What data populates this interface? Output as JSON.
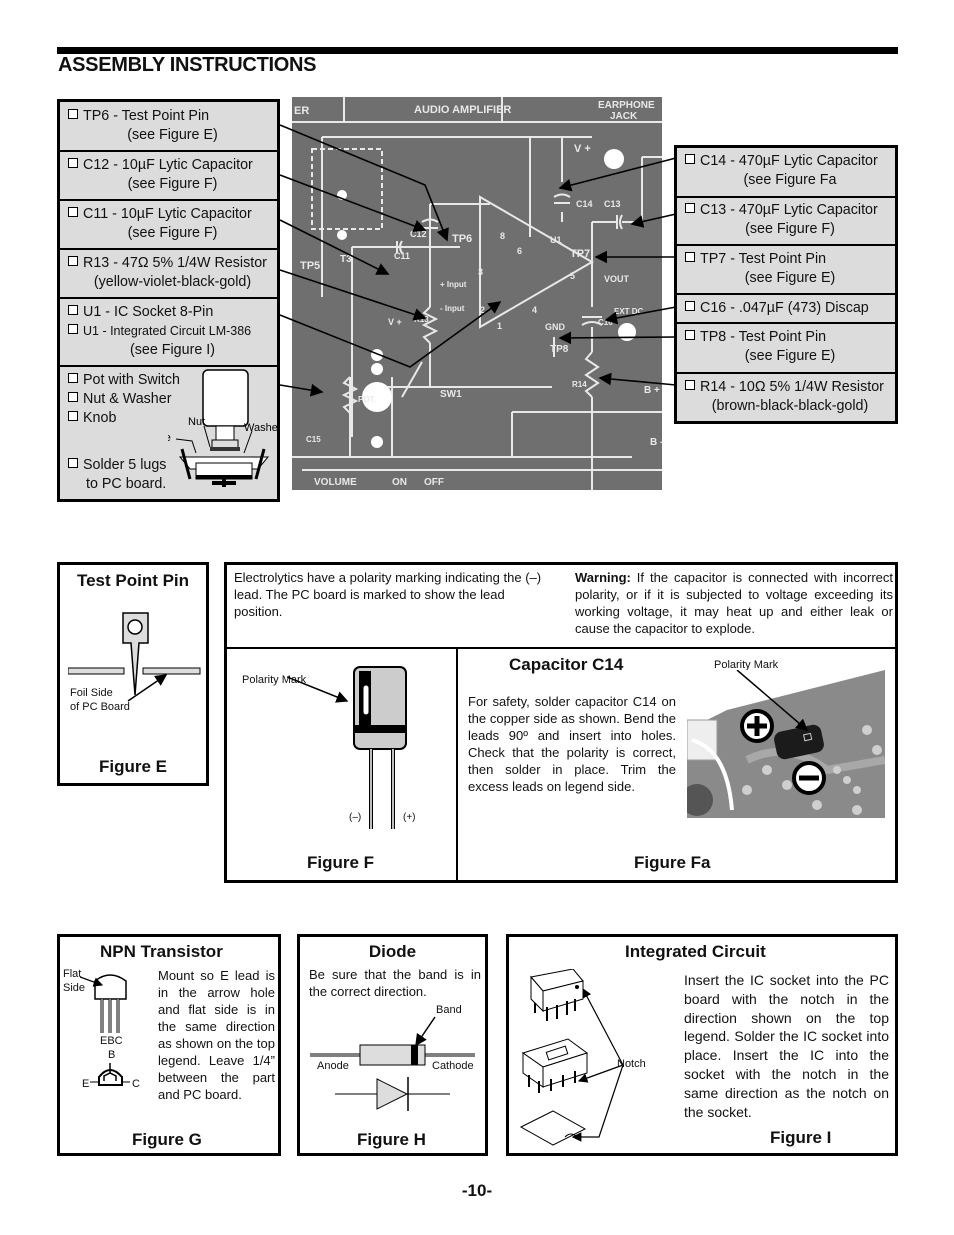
{
  "page": {
    "title": "ASSEMBLY INSTRUCTIONS",
    "page_number": "-10-"
  },
  "left_parts": [
    {
      "line1": "TP6 - Test Point Pin",
      "line2": "(see Figure E)"
    },
    {
      "line1": "C12 - 10µF Lytic Capacitor",
      "line2": "(see Figure F)"
    },
    {
      "line1": "C11 - 10µF Lytic Capacitor",
      "line2": "(see Figure F)"
    },
    {
      "line1": "R13 - 47Ω 5% 1/4W Resistor",
      "line2": "(yellow-violet-black-gold)"
    },
    {
      "line1": "U1 - IC Socket 8-Pin",
      "line1b": "U1 - Integrated Circuit LM-386",
      "line2": "(see Figure I)"
    }
  ],
  "pot_cell": {
    "items": [
      "Pot with Switch",
      "Nut & Washer",
      "Knob"
    ],
    "solder_line1": "Solder 5 lugs",
    "solder_line2": "to PC board.",
    "labels": {
      "nut": "Nut",
      "washer": "Washer",
      "top_side": "Top Side"
    }
  },
  "right_parts": [
    {
      "line1": "C14 - 470µF Lytic Capacitor",
      "line2": "(see Figure Fa"
    },
    {
      "line1": "C13 - 470µF Lytic Capacitor",
      "line2": "(see Figure F)"
    },
    {
      "line1": "TP7 - Test Point Pin",
      "line2": "(see Figure E)"
    },
    {
      "line1": "C16 - .047µF (473) Discap"
    },
    {
      "line1": "TP8 - Test Point Pin",
      "line2": "(see Figure E)"
    },
    {
      "line1": "R14 - 10Ω 5% 1/4W Resistor",
      "line2": "(brown-black-black-gold)"
    }
  ],
  "pcb": {
    "sections": [
      "ER",
      "AUDIO AMPLIFIER",
      "EARPHONE",
      "JACK"
    ],
    "labels": {
      "vplus": "V +",
      "c14": "C14",
      "c13": "C13",
      "u1": "U1",
      "tp7": "TP7",
      "vout": "VOUT",
      "tp6": "TP6",
      "c12": "C12",
      "c11": "C11",
      "tp5": "TP5",
      "t3": "T3",
      "plus_input": "+ Input",
      "minus_input": "- Input",
      "r13": "R13",
      "vplus2": "V +",
      "pin8": "8",
      "pin6": "6",
      "pin3": "3",
      "pin5": "5",
      "pin2": "2",
      "pin4": "4",
      "pin1": "1",
      "gnd": "GND",
      "tp8": "TP8",
      "c16": "C16",
      "ext_dc": "EXT DC",
      "r14": "R14",
      "pot": "POT.",
      "sw1": "SW1",
      "c15": "C15",
      "bplus": "B +",
      "bminus": "B -",
      "volume": "VOLUME",
      "on": "ON",
      "off": "OFF"
    }
  },
  "figure_e": {
    "title": "Test Point Pin",
    "label_line1": "Foil Side",
    "label_line2": "of PC Board",
    "caption": "Figure E"
  },
  "electrolytics": {
    "text": "Electrolytics have a polarity marking indicating the (–) lead.  The PC board is marked to show the lead position.",
    "warning_label": "Warning:",
    "warning_text": " If the capacitor is connected with incorrect polarity, or if it is subjected to voltage exceeding its working voltage, it may heat up and either leak or cause the capacitor to explode."
  },
  "figure_f": {
    "polarity_label": "Polarity Mark",
    "neg": "(–)",
    "pos": "(+)",
    "caption": "Figure F"
  },
  "figure_fa": {
    "title": "Capacitor C14",
    "text": "For safety, solder capacitor C14 on the copper side as shown. Bend the leads 90º and insert into holes.  Check that the polarity is correct, then solder in place.  Trim the excess leads on legend side.",
    "polarity_label": "Polarity Mark",
    "caption": "Figure Fa"
  },
  "figure_g": {
    "title": "NPN Transistor",
    "flat": "Flat",
    "side": "Side",
    "ebc": "EBC",
    "b": "B",
    "e": "E",
    "c": "C",
    "text": "Mount so E lead is in the arrow hole and flat side is in the same direction as shown on the top legend. Leave 1/4” between the part and PC board.",
    "caption": "Figure G"
  },
  "figure_h": {
    "title": "Diode",
    "text": "Be sure that the band is in the correct direction.",
    "band": "Band",
    "anode": "Anode",
    "cathode": "Cathode",
    "caption": "Figure H"
  },
  "figure_i": {
    "title": "Integrated Circuit",
    "notch": "Notch",
    "text": "Insert the IC socket into the PC board with the notch in the direction shown on the top legend.  Solder the IC socket into place.  Insert the IC into the socket with the notch in the same direction as the notch on the socket.",
    "caption": "Figure I"
  }
}
